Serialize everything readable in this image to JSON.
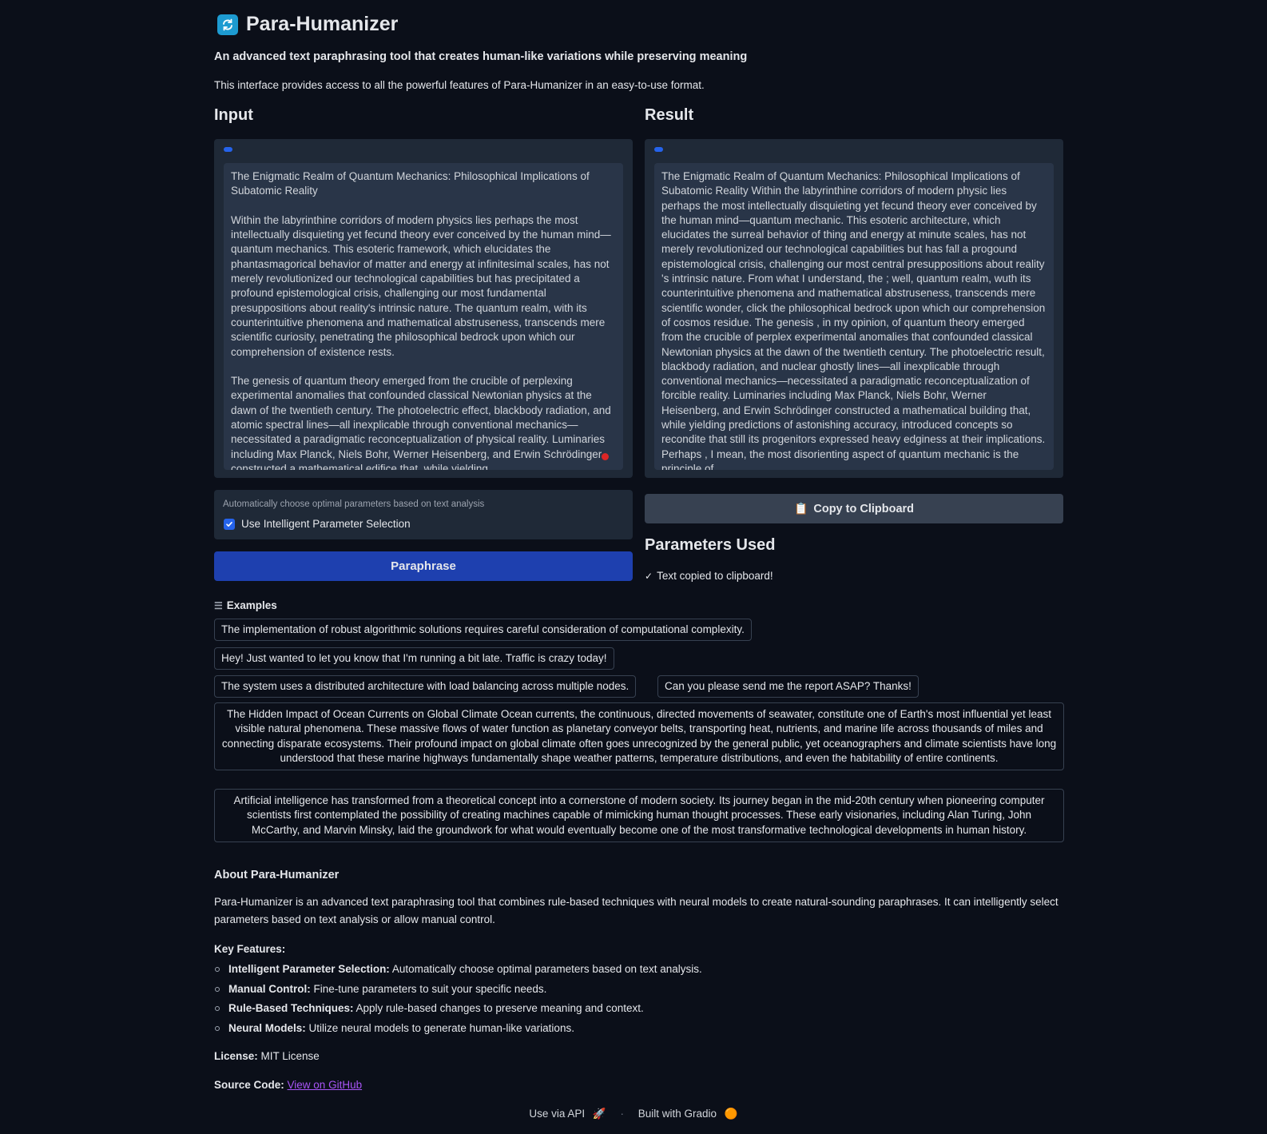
{
  "app": {
    "title": "Para-Humanizer",
    "tagline": "An advanced text paraphrasing tool that creates human-like variations while preserving meaning",
    "intro": "This interface provides access to all the powerful features of Para-Humanizer in an easy-to-use format."
  },
  "input": {
    "title": "Input",
    "text": "The Enigmatic Realm of Quantum Mechanics: Philosophical Implications of Subatomic Reality\n\nWithin the labyrinthine corridors of modern physics lies perhaps the most intellectually disquieting yet fecund theory ever conceived by the human mind—quantum mechanics. This esoteric framework, which elucidates the phantasmagorical behavior of matter and energy at infinitesimal scales, has not merely revolutionized our technological capabilities but has precipitated a profound epistemological crisis, challenging our most fundamental presuppositions about reality's intrinsic nature. The quantum realm, with its counterintuitive phenomena and mathematical abstruseness, transcends mere scientific curiosity, penetrating the philosophical bedrock upon which our comprehension of existence rests.\n\nThe genesis of quantum theory emerged from the crucible of perplexing experimental anomalies that confounded classical Newtonian physics at the dawn of the twentieth century. The photoelectric effect, blackbody radiation, and atomic spectral lines—all inexplicable through conventional mechanics—necessitated a paradigmatic reconceptualization of physical reality. Luminaries including Max Planck, Niels Bohr, Werner Heisenberg, and Erwin Schrödinger constructed a mathematical edifice that, while yielding"
  },
  "result": {
    "title": "Result",
    "text": "The Enigmatic Realm of Quantum Mechanics: Philosophical Implications of Subatomic Reality Within the labyrinthine corridors of modern physic lies perhaps the most intellectually disquieting yet fecund theory ever conceived by the human mind—quantum mechanic. This esoteric architecture, which elucidates the surreal behavior of thing and energy at minute scales, has not merely revolutionized our technological capabilities but has fall a progound epistemological crisis, challenging our most central presuppositions about reality 's intrinsic nature. From what I understand, the ; well, quantum realm, wuth its counterintuitive phenomena and mathematical abstruseness, transcends mere scientific wonder, click the philosophical bedrock upon which our comprehension of cosmos residue. The genesis , in my opinion, of quantum theory emerged from the crucible of perplex experimental anomalies that confounded classical Newtonian physics at the dawn of the twentieth century. The photoelectric result, blackbody radiation, and nuclear ghostly lines—all inexplicable through conventional mechanics—necessitated a paradigmatic reconceptualization of forcible reality. Luminaries including Max Planck, Niels Bohr, Werner Heisenberg, and Erwin Schrödinger constructed a mathematical building that, while yielding predictions of astonishing accuracy, introduced concepts so recondite that still its progenitors expressed heavy edginess at their implications. Perhaps , I mean, the most disorienting aspect of quantum mechanic is the principle of"
  },
  "intelligent": {
    "info": "Automatically choose optimal parameters based on text analysis",
    "label": "Use Intelligent Parameter Selection",
    "checked": true
  },
  "buttons": {
    "paraphrase": "Paraphrase",
    "copy": "Copy to Clipboard"
  },
  "params": {
    "title": "Parameters Used",
    "message": "Text copied to clipboard!"
  },
  "examples": {
    "label": "Examples",
    "items": [
      "The implementation of robust algorithmic solutions requires careful consideration of computational complexity.",
      "Hey! Just wanted to let you know that I'm running a bit late. Traffic is crazy today!",
      "The system uses a distributed architecture with load balancing across multiple nodes.",
      "Can you please send me the report ASAP? Thanks!",
      "The Hidden Impact of Ocean Currents on Global Climate Ocean currents, the continuous, directed movements of seawater, constitute one of Earth's most influential yet least visible natural phenomena. These massive flows of water function as planetary conveyor belts, transporting heat, nutrients, and marine life across thousands of miles and connecting disparate ecosystems. Their profound impact on global climate often goes unrecognized by the general public, yet oceanographers and climate scientists have long understood that these marine highways fundamentally shape weather patterns, temperature distributions, and even the habitability of entire continents.",
      "Artificial intelligence has transformed from a theoretical concept into a cornerstone of modern society. Its journey began in the mid-20th century when pioneering computer scientists first contemplated the possibility of creating machines capable of mimicking human thought processes. These early visionaries, including Alan Turing, John McCarthy, and Marvin Minsky, laid the groundwork for what would eventually become one of the most transformative technological developments in human history."
    ]
  },
  "about": {
    "title": "About Para-Humanizer",
    "text": "Para-Humanizer is an advanced text paraphrasing tool that combines rule-based techniques with neural models to create natural-sounding paraphrases. It can intelligently select parameters based on text analysis or allow manual control.",
    "features_title": "Key Features:",
    "features": [
      {
        "name": "Intelligent Parameter Selection:",
        "desc": " Automatically choose optimal parameters based on text analysis."
      },
      {
        "name": "Manual Control:",
        "desc": " Fine-tune parameters to suit your specific needs."
      },
      {
        "name": "Rule-Based Techniques:",
        "desc": " Apply rule-based changes to preserve meaning and context."
      },
      {
        "name": "Neural Models:",
        "desc": " Utilize neural models to generate human-like variations."
      }
    ],
    "license_label": "License:",
    "license_value": " MIT License",
    "source_label": "Source Code:",
    "source_link": "View on GitHub"
  },
  "footer": {
    "api": "Use via API",
    "api_icon": "🚀",
    "sep": "·",
    "built": "Built with Gradio",
    "built_icon": "🟠"
  },
  "colors": {
    "background": "#0b0f19",
    "panel": "#1f2937",
    "primary": "#1e40af",
    "link": "#a855f7"
  }
}
